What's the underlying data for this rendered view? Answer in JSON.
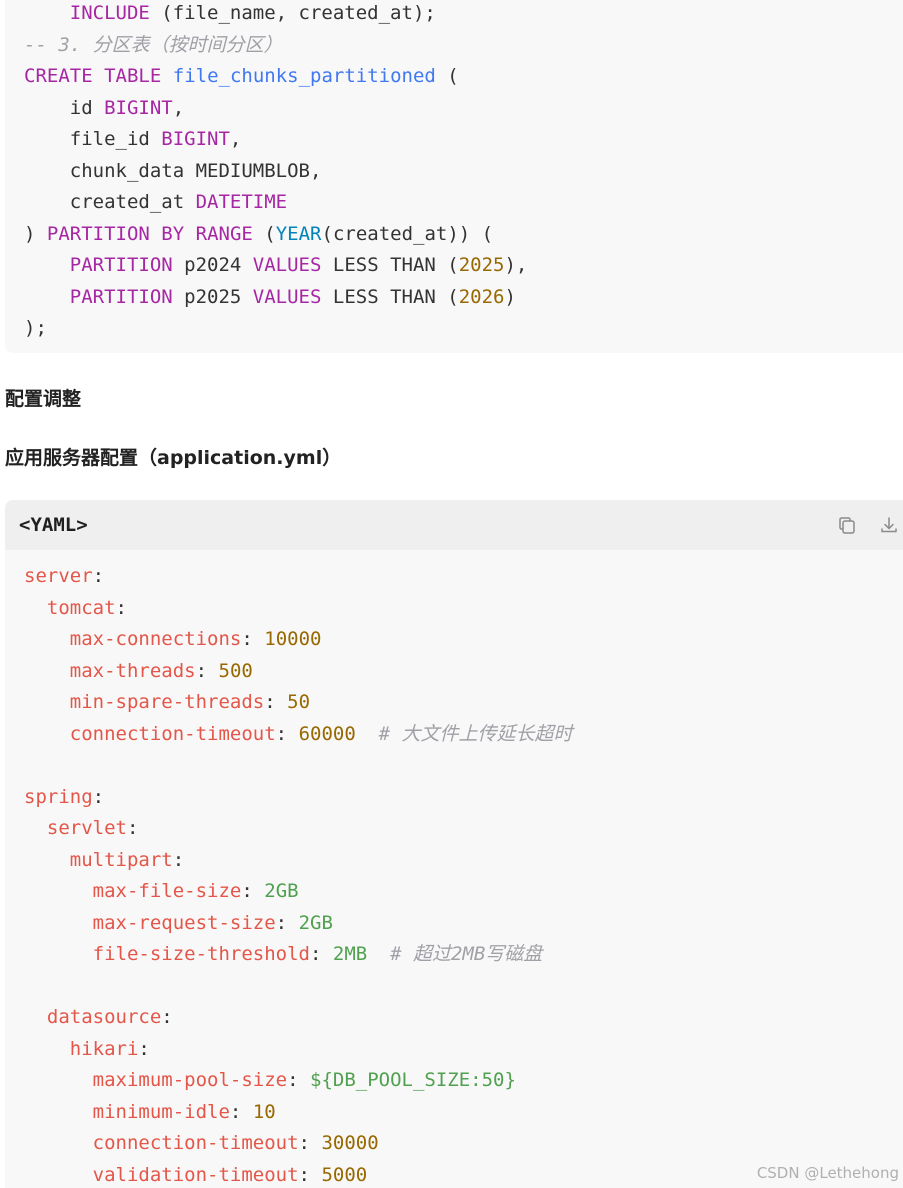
{
  "sql_block": {
    "lines": [
      [
        {
          "t": "    "
        },
        {
          "t": "INCLUDE",
          "c": "kw"
        },
        {
          "t": " (file_name, created_at);"
        }
      ],
      [
        {
          "t": "-- 3. 分区表（按时间分区）",
          "c": "cm"
        }
      ],
      [
        {
          "t": "CREATE",
          "c": "kw"
        },
        {
          "t": " "
        },
        {
          "t": "TABLE",
          "c": "kw"
        },
        {
          "t": " "
        },
        {
          "t": "file_chunks_partitioned",
          "c": "fn"
        },
        {
          "t": " ("
        }
      ],
      [
        {
          "t": "    id "
        },
        {
          "t": "BIGINT",
          "c": "kw"
        },
        {
          "t": ","
        }
      ],
      [
        {
          "t": "    file_id "
        },
        {
          "t": "BIGINT",
          "c": "kw"
        },
        {
          "t": ","
        }
      ],
      [
        {
          "t": "    chunk_data MEDIUMBLOB,"
        }
      ],
      [
        {
          "t": "    created_at "
        },
        {
          "t": "DATETIME",
          "c": "kw"
        }
      ],
      [
        {
          "t": ") "
        },
        {
          "t": "PARTITION",
          "c": "kw"
        },
        {
          "t": " "
        },
        {
          "t": "BY",
          "c": "kw"
        },
        {
          "t": " "
        },
        {
          "t": "RANGE",
          "c": "kw"
        },
        {
          "t": " ("
        },
        {
          "t": "YEAR",
          "c": "bi"
        },
        {
          "t": "(created_at)) ("
        }
      ],
      [
        {
          "t": "    "
        },
        {
          "t": "PARTITION",
          "c": "kw"
        },
        {
          "t": " p2024 "
        },
        {
          "t": "VALUES",
          "c": "kw"
        },
        {
          "t": " LESS THAN ("
        },
        {
          "t": "2025",
          "c": "num"
        },
        {
          "t": "),"
        }
      ],
      [
        {
          "t": "    "
        },
        {
          "t": "PARTITION",
          "c": "kw"
        },
        {
          "t": " p2025 "
        },
        {
          "t": "VALUES",
          "c": "kw"
        },
        {
          "t": " LESS THAN ("
        },
        {
          "t": "2026",
          "c": "num"
        },
        {
          "t": ")"
        }
      ],
      [
        {
          "t": ");"
        }
      ]
    ]
  },
  "headings": {
    "config_adjust": "配置调整",
    "app_server_config": "应用服务器配置（application.yml）"
  },
  "yaml_block": {
    "language_label": "<YAML>",
    "icons": {
      "copy": "copy-icon",
      "download": "download-icon"
    },
    "lines": [
      [
        {
          "t": "server",
          "c": "key"
        },
        {
          "t": ":"
        }
      ],
      [
        {
          "t": "  "
        },
        {
          "t": "tomcat",
          "c": "key"
        },
        {
          "t": ":"
        }
      ],
      [
        {
          "t": "    "
        },
        {
          "t": "max-connections",
          "c": "key"
        },
        {
          "t": ": "
        },
        {
          "t": "10000",
          "c": "yn"
        }
      ],
      [
        {
          "t": "    "
        },
        {
          "t": "max-threads",
          "c": "key"
        },
        {
          "t": ": "
        },
        {
          "t": "500",
          "c": "yn"
        }
      ],
      [
        {
          "t": "    "
        },
        {
          "t": "min-spare-threads",
          "c": "key"
        },
        {
          "t": ": "
        },
        {
          "t": "50",
          "c": "yn"
        }
      ],
      [
        {
          "t": "    "
        },
        {
          "t": "connection-timeout",
          "c": "key"
        },
        {
          "t": ": "
        },
        {
          "t": "60000",
          "c": "yn"
        },
        {
          "t": "  "
        },
        {
          "t": "# 大文件上传延长超时",
          "c": "cm"
        }
      ],
      [
        {
          "t": ""
        }
      ],
      [
        {
          "t": "spring",
          "c": "key"
        },
        {
          "t": ":"
        }
      ],
      [
        {
          "t": "  "
        },
        {
          "t": "servlet",
          "c": "key"
        },
        {
          "t": ":"
        }
      ],
      [
        {
          "t": "    "
        },
        {
          "t": "multipart",
          "c": "key"
        },
        {
          "t": ":"
        }
      ],
      [
        {
          "t": "      "
        },
        {
          "t": "max-file-size",
          "c": "key"
        },
        {
          "t": ": "
        },
        {
          "t": "2GB",
          "c": "str"
        }
      ],
      [
        {
          "t": "      "
        },
        {
          "t": "max-request-size",
          "c": "key"
        },
        {
          "t": ": "
        },
        {
          "t": "2GB",
          "c": "str"
        }
      ],
      [
        {
          "t": "      "
        },
        {
          "t": "file-size-threshold",
          "c": "key"
        },
        {
          "t": ": "
        },
        {
          "t": "2MB",
          "c": "str"
        },
        {
          "t": "  "
        },
        {
          "t": "# 超过2MB写磁盘",
          "c": "cm"
        }
      ],
      [
        {
          "t": ""
        }
      ],
      [
        {
          "t": "  "
        },
        {
          "t": "datasource",
          "c": "key"
        },
        {
          "t": ":"
        }
      ],
      [
        {
          "t": "    "
        },
        {
          "t": "hikari",
          "c": "key"
        },
        {
          "t": ":"
        }
      ],
      [
        {
          "t": "      "
        },
        {
          "t": "maximum-pool-size",
          "c": "key"
        },
        {
          "t": ": "
        },
        {
          "t": "${DB_POOL_SIZE:50}",
          "c": "str"
        }
      ],
      [
        {
          "t": "      "
        },
        {
          "t": "minimum-idle",
          "c": "key"
        },
        {
          "t": ": "
        },
        {
          "t": "10",
          "c": "yn"
        }
      ],
      [
        {
          "t": "      "
        },
        {
          "t": "connection-timeout",
          "c": "key"
        },
        {
          "t": ": "
        },
        {
          "t": "30000",
          "c": "yn"
        }
      ],
      [
        {
          "t": "      "
        },
        {
          "t": "validation-timeout",
          "c": "key"
        },
        {
          "t": ": "
        },
        {
          "t": "5000",
          "c": "yn"
        }
      ]
    ]
  },
  "watermark": "CSDN @Lethehong"
}
